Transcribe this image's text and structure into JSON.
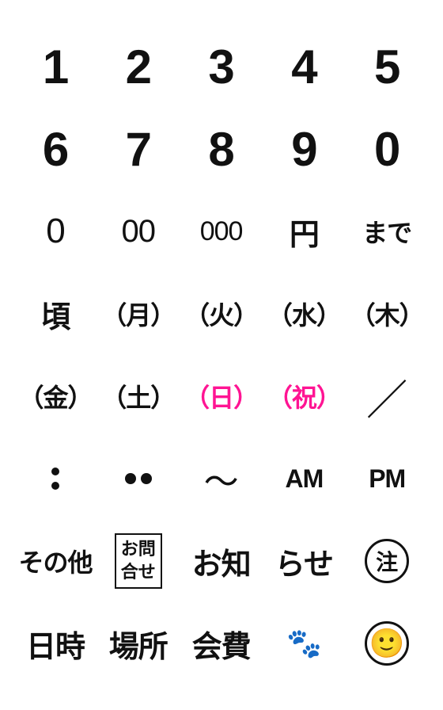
{
  "grid": {
    "rows": [
      [
        {
          "id": "num1",
          "text": "1",
          "type": "large-num"
        },
        {
          "id": "num2",
          "text": "2",
          "type": "large-num"
        },
        {
          "id": "num3",
          "text": "3",
          "type": "large-num"
        },
        {
          "id": "num4",
          "text": "4",
          "type": "large-num"
        },
        {
          "id": "num5",
          "text": "5",
          "type": "large-num"
        }
      ],
      [
        {
          "id": "num6",
          "text": "6",
          "type": "large-num"
        },
        {
          "id": "num7",
          "text": "7",
          "type": "large-num"
        },
        {
          "id": "num8",
          "text": "8",
          "type": "large-num"
        },
        {
          "id": "num9",
          "text": "9",
          "type": "large-num"
        },
        {
          "id": "num0",
          "text": "0",
          "type": "large-num"
        }
      ],
      [
        {
          "id": "zero1",
          "text": "0",
          "type": "outline-circle"
        },
        {
          "id": "zero2",
          "text": "00",
          "type": "outline-circle"
        },
        {
          "id": "zero3",
          "text": "000",
          "type": "outline-circle"
        },
        {
          "id": "yen",
          "text": "円",
          "type": "kanji"
        },
        {
          "id": "made",
          "text": "まで",
          "type": "kanji"
        }
      ],
      [
        {
          "id": "goro",
          "text": "頃",
          "type": "kanji"
        },
        {
          "id": "mon",
          "text": "（月）",
          "type": "kanji-day"
        },
        {
          "id": "tue",
          "text": "（火）",
          "type": "kanji-day"
        },
        {
          "id": "wed",
          "text": "（水）",
          "type": "kanji-day"
        },
        {
          "id": "thu",
          "text": "（木）",
          "type": "kanji-day"
        }
      ],
      [
        {
          "id": "fri",
          "text": "（金）",
          "type": "kanji-day"
        },
        {
          "id": "sat",
          "text": "（土）",
          "type": "kanji-day"
        },
        {
          "id": "sun",
          "text": "（日）",
          "type": "kanji-day-pink"
        },
        {
          "id": "hol",
          "text": "（祝）",
          "type": "kanji-day-pink"
        },
        {
          "id": "slash",
          "text": "／",
          "type": "slash"
        }
      ],
      [
        {
          "id": "colon",
          "text": ":",
          "type": "colon"
        },
        {
          "id": "dots",
          "text": "••",
          "type": "dots"
        },
        {
          "id": "wave",
          "text": "〜",
          "type": "wave"
        },
        {
          "id": "am",
          "text": "AM",
          "type": "am-pm"
        },
        {
          "id": "pm",
          "text": "PM",
          "type": "am-pm"
        }
      ],
      [
        {
          "id": "sonota",
          "text": "その他",
          "type": "kanji-small"
        },
        {
          "id": "toiawase",
          "text": "お問合せ",
          "type": "box"
        },
        {
          "id": "oshiri",
          "text": "お知",
          "type": "kanji"
        },
        {
          "id": "raise",
          "text": "らせ",
          "type": "kanji"
        },
        {
          "id": "chu",
          "text": "注",
          "type": "circle"
        }
      ],
      [
        {
          "id": "nichiji",
          "text": "日時",
          "type": "kanji"
        },
        {
          "id": "basho",
          "text": "場所",
          "type": "kanji"
        },
        {
          "id": "kaigi",
          "text": "会費",
          "type": "kanji"
        },
        {
          "id": "paw",
          "text": "🐾",
          "type": "paw"
        },
        {
          "id": "smile",
          "text": "☺",
          "type": "smile"
        }
      ]
    ]
  }
}
